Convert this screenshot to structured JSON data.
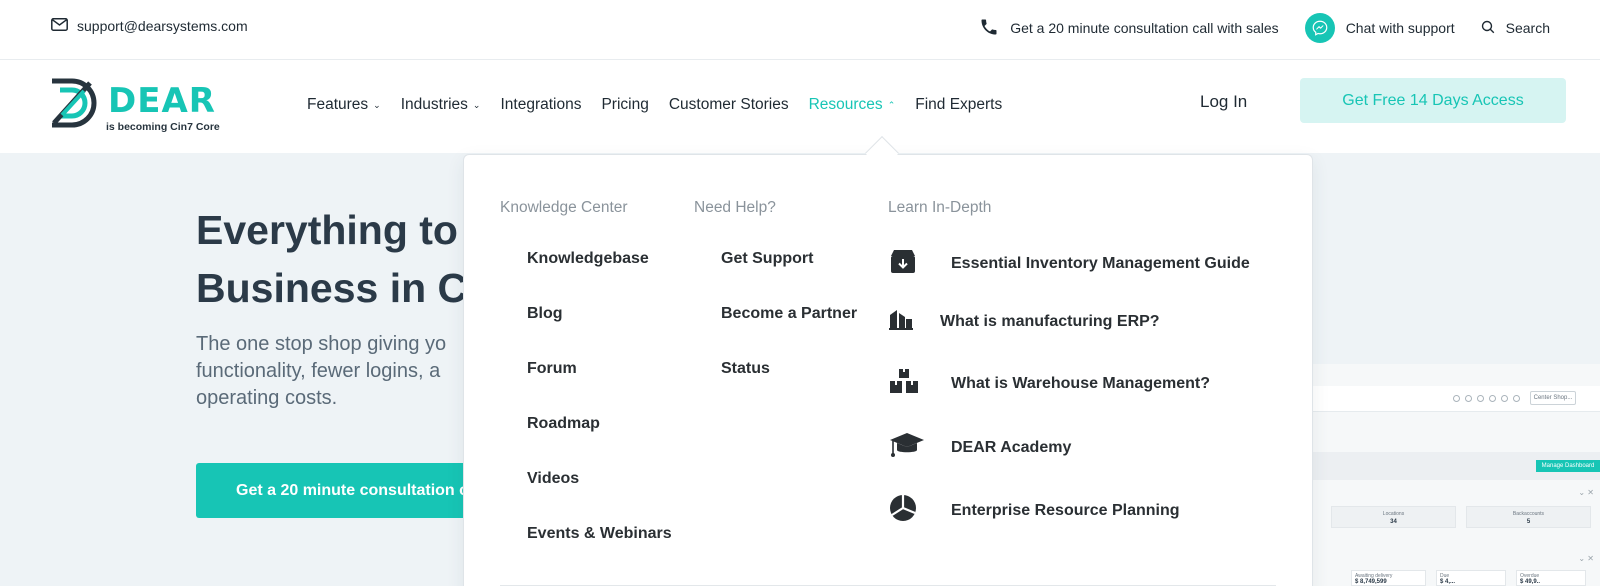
{
  "topbar": {
    "email": "support@dearsystems.com",
    "call": "Get a 20 minute consultation call with sales",
    "chat": "Chat with support",
    "search": "Search"
  },
  "nav": {
    "logo_word": "DEAR",
    "logo_tag": "is becoming Cin7 Core",
    "items": [
      {
        "label": "Features",
        "has_chevron": true
      },
      {
        "label": "Industries",
        "has_chevron": true
      },
      {
        "label": "Integrations"
      },
      {
        "label": "Pricing"
      },
      {
        "label": "Customer Stories"
      },
      {
        "label": "Resources",
        "has_chevron": true,
        "active": true
      },
      {
        "label": "Find Experts"
      }
    ],
    "login": "Log In",
    "cta": "Get Free 14 Days Access"
  },
  "hero": {
    "title_line1": "Everything to",
    "title_line2": "Business in C",
    "subtitle": "The one stop shop giving yo functionality, fewer logins, a operating costs.",
    "cta": "Get a 20 minute consultation c"
  },
  "dropdown": {
    "knowledge": {
      "heading": "Knowledge Center",
      "links": [
        "Knowledgebase",
        "Blog",
        "Forum",
        "Roadmap",
        "Videos",
        "Events & Webinars"
      ]
    },
    "help": {
      "heading": "Need Help?",
      "links": [
        "Get Support",
        "Become a Partner",
        "Status"
      ]
    },
    "learn": {
      "heading": "Learn In-Depth",
      "items": [
        {
          "label": "Essential Inventory Management Guide",
          "icon": "archive-box-icon"
        },
        {
          "label": "What is manufacturing ERP?",
          "icon": "factory-icon"
        },
        {
          "label": "What is Warehouse Management?",
          "icon": "stacked-boxes-icon"
        },
        {
          "label": "DEAR Academy",
          "icon": "graduation-cap-icon"
        },
        {
          "label": "Enterprise Resource Planning",
          "icon": "pie-chart-icon"
        }
      ]
    }
  },
  "dashboard": {
    "control": "Center Shop...",
    "button": "Manage Dashboard",
    "cards": [
      {
        "label": "Locations",
        "value": "34"
      },
      {
        "label": "Backaccounts",
        "value": "5"
      }
    ],
    "mini": [
      {
        "label": "Awaiting delivery",
        "value": "$ 8,749,599"
      },
      {
        "label": "Due",
        "value": "$ 4,..."
      },
      {
        "label": "Overdue",
        "value": "$ 49,9.."
      }
    ]
  },
  "colors": {
    "brand": "#17c5b5",
    "cta_light": "#d6f4f2",
    "hero_bg": "#eef3f6",
    "title": "#2b3a48"
  }
}
